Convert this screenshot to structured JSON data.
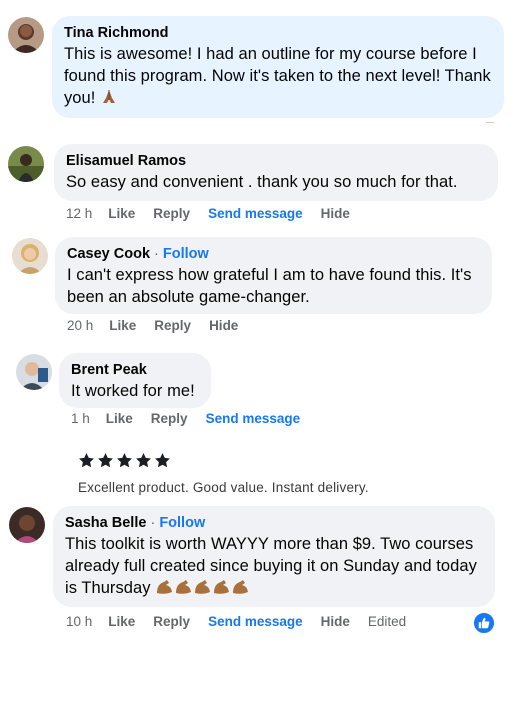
{
  "comments": [
    {
      "author": "Tina Richmond",
      "text": "This is awesome! I had an outline for my course before I found this program. Now it's taken to the next level! Thank you!",
      "emoji_icon": "praying-hands-icon"
    },
    {
      "author": "Elisamuel Ramos",
      "text": "So easy and convenient . thank you so much for that.",
      "time": "12 h",
      "like": "Like",
      "reply": "Reply",
      "send": "Send message",
      "hide": "Hide"
    },
    {
      "author": "Casey Cook",
      "separator": " · ",
      "follow": "Follow",
      "text": "I can't express how grateful I am to have found this. It's been an absolute game-changer.",
      "time": "20 h",
      "like": "Like",
      "reply": "Reply",
      "hide": "Hide"
    },
    {
      "author": "Brent Peak",
      "text": "It worked for me!",
      "time": "1 h",
      "like": "Like",
      "reply": "Reply",
      "send": "Send message"
    },
    {
      "author": "Sasha Belle",
      "separator": " · ",
      "follow": "Follow",
      "text": "This toolkit is worth WAYYY more than $9. Two courses already full created since buying it on Sunday and today is Thursday",
      "emoji_icon": "flexed-biceps-icon",
      "emoji_count": 5,
      "time": "10 h",
      "like": "Like",
      "reply": "Reply",
      "send": "Send message",
      "hide": "Hide",
      "edited": "Edited",
      "reaction_icon": "like-reaction-icon"
    }
  ],
  "review": {
    "stars": 5,
    "text": "Excellent product. Good value. Instant delivery."
  },
  "colors": {
    "bubble": "#f0f2f5",
    "bubble_highlight": "#e7f3ff",
    "link_blue": "#1877f2",
    "meta_gray": "#65676b"
  }
}
